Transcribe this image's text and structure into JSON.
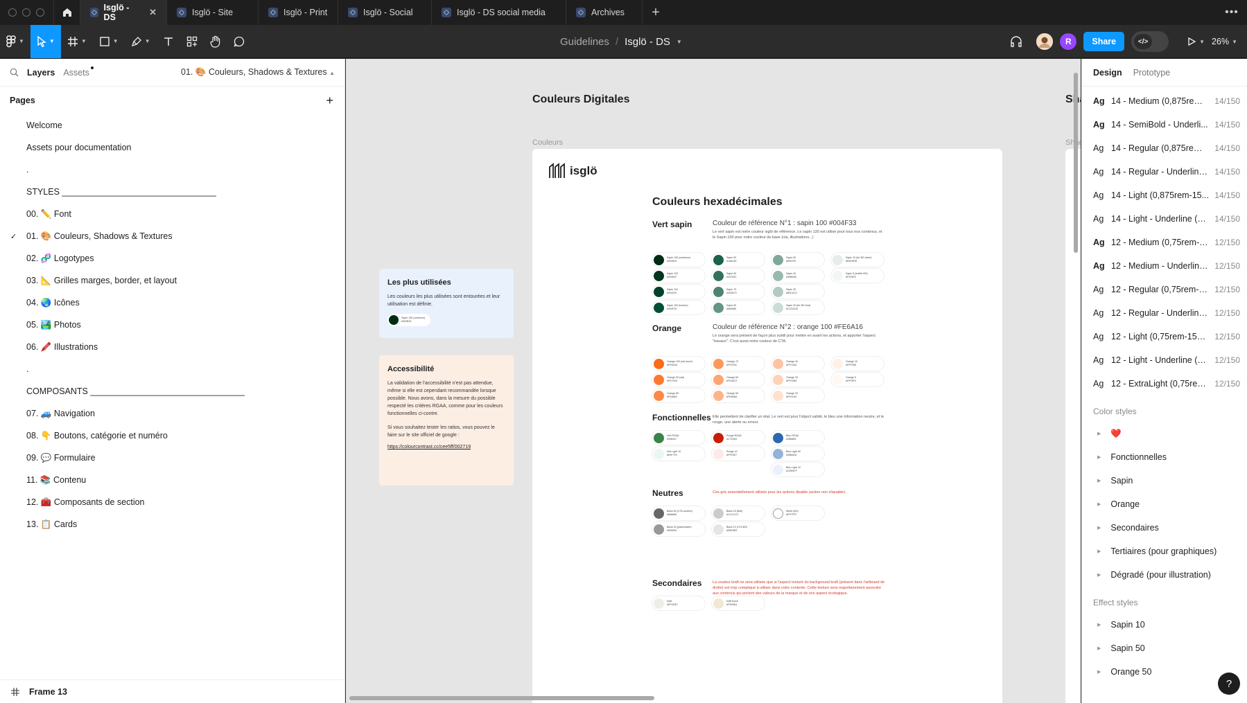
{
  "tabs": [
    {
      "label": "Isglö - DS",
      "active": true
    },
    {
      "label": "Isglö - Site"
    },
    {
      "label": "Isglö - Print"
    },
    {
      "label": "Isglö - Social"
    },
    {
      "label": "Isglö - DS social media"
    },
    {
      "label": "Archives"
    }
  ],
  "toolbar": {
    "breadcrumb_parent": "Guidelines",
    "breadcrumb_sep": "/",
    "breadcrumb_current": "Isglö - DS",
    "avatar_r": "R",
    "share_label": "Share",
    "zoom": "26%"
  },
  "left_panel": {
    "tab_layers": "Layers",
    "tab_assets": "Assets",
    "current_page": "01. 🎨 Couleurs, Shadows & Textures",
    "pages_title": "Pages",
    "pages": [
      {
        "label": "Welcome"
      },
      {
        "label": "Assets pour documentation"
      },
      {
        "label": "."
      },
      {
        "label": "STYLES ________________________________"
      },
      {
        "label": "00. ✏️ Font"
      },
      {
        "label": "01. 🎨 Couleurs, Shadows & Textures",
        "current": true
      },
      {
        "label": "02. 🧬 Logotypes"
      },
      {
        "label": "03. 📐 Grilles marges, border, et layout"
      },
      {
        "label": "04. 🌏 Icônes"
      },
      {
        "label": "05. 🏞️ Photos"
      },
      {
        "label": "06. 🖍️ Illustrations"
      },
      {
        "label": "."
      },
      {
        "label": "COMPOSANTS ________________________________"
      },
      {
        "label": "07. 🚙 Navigation"
      },
      {
        "label": "08. 👇 Boutons, catégorie et numéro"
      },
      {
        "label": "09. 💬 Formulaire"
      },
      {
        "label": "11. 📚 Contenu"
      },
      {
        "label": "12. 🧰 Composants de section"
      },
      {
        "label": "13. 📋 Cards"
      }
    ],
    "footer_label": "Frame 13"
  },
  "canvas": {
    "frame_title": "Couleurs Digitales",
    "frame_label": "Couleurs",
    "peek_title": "Sha",
    "peek_label": "Shad",
    "logo_text": "isglö",
    "main_title": "Couleurs hexadécimales",
    "card_used": {
      "title": "Les plus utilisées",
      "text": "Les couleurs les plus utilisées sont entourées et leur utilisation est définie.",
      "chip_name": "Sapin 130 (contenus)",
      "chip_hex": "#002B15",
      "chip_color": "#002B15"
    },
    "card_access": {
      "title": "Accessibilité",
      "text1": "La validation de l'accessibilité n'est pas attendue, même si elle est cependant recommandée lorsque possible. Nous avons, dans la mesure du possible respecté les critères RGAA, comme pour les couleurs fonctionnelles ci-contre.",
      "text2": "Si vous souhaitez tester les ratios, vous pouvez le faire sur le site officiel de google :",
      "link": "https://colourcontrast.cc/cee5ff/002719"
    },
    "sections": [
      {
        "name": "Vert sapin",
        "ref": "Couleur de référence N°1 : sapin 100 #004F33",
        "desc": "Le vert sapin est notre couleur isglö de référence. Le sapin 130 est utilisé pour tous nos contenus, et le Sapin 100 pour notre couleur de base (cta, illustrations...)",
        "swatches": [
          {
            "name": "Sapin 130 (contenus)",
            "hex": "#002B15",
            "color": "#002B15"
          },
          {
            "name": "Sapin 120",
            "hex": "#00351F",
            "color": "#00351F"
          },
          {
            "name": "Sapin 110",
            "hex": "#004229",
            "color": "#004229"
          },
          {
            "name": "Sapin 100 (bouton)",
            "hex": "#004F33",
            "color": "#004F33"
          },
          {
            "name": "Sapin 90",
            "hex": "#1A614E",
            "color": "#1A614E"
          },
          {
            "name": "Sapin 80",
            "hex": "#33725C",
            "color": "#33725C"
          },
          {
            "name": "Sapin 70",
            "hex": "#4D8470",
            "color": "#4D8470"
          },
          {
            "name": "Sapin 60",
            "hex": "#669585",
            "color": "#669585"
          },
          {
            "name": "Sapin 50",
            "hex": "#80A799",
            "color": "#80A799"
          },
          {
            "name": "Sapin 40",
            "hex": "#99B9AD",
            "color": "#99B9AD"
          },
          {
            "name": "Sapin 30",
            "hex": "#B3CAC2",
            "color": "#B3CAC2"
          },
          {
            "name": "Sapin 20 (fer BG brut)",
            "hex": "#CCDCD6",
            "color": "#CCDCD6"
          },
          {
            "name": "Sapin 10 (fer BG claire)",
            "hex": "#E6EDEB",
            "color": "#E6EDEB"
          },
          {
            "name": "Sapin 5 (entête BG)",
            "hex": "#F2F6F5",
            "color": "#F2F6F5"
          }
        ]
      },
      {
        "name": "Orange",
        "ref": "Couleur de référence N°2 : orange 100 #FE6A16",
        "desc": "Le orange sera présent de façon plus subtil pour mettre en avant les actions, et apporter l'aspect \"travaux\". C'est aussi notre couleur de CTA.",
        "swatches": [
          {
            "name": "Orange 100 (cta hover)",
            "hex": "#FE6A16",
            "color": "#FE6A16"
          },
          {
            "name": "Orange 90 (cta)",
            "hex": "#FE792D",
            "color": "#FE792D"
          },
          {
            "name": "Orange 80",
            "hex": "#FE8845",
            "color": "#FE8845"
          },
          {
            "name": "Orange 70",
            "hex": "#FE975C",
            "color": "#FE975C"
          },
          {
            "name": "Orange 60",
            "hex": "#FEA673",
            "color": "#FEA673"
          },
          {
            "name": "Orange 50",
            "hex": "#FEB48A",
            "color": "#FEB48A"
          },
          {
            "name": "Orange 40",
            "hex": "#FFC3A2",
            "color": "#FFC3A2"
          },
          {
            "name": "Orange 30",
            "hex": "#FFD2B9",
            "color": "#FFD2B9"
          },
          {
            "name": "Orange 20",
            "hex": "#FFE1D0",
            "color": "#FFE1D0"
          },
          {
            "name": "Orange 10",
            "hex": "#FFF0E8",
            "color": "#FFF0E8"
          },
          {
            "name": "Orange 5",
            "hex": "#FFF8F3",
            "color": "#FFF8F3"
          }
        ]
      },
      {
        "name": "Fonctionnelles",
        "ref": "",
        "desc": "Elle permettent de clarifier un état. Le vert est pour l'object validé, le bleu une information neutre, et le rouge, une alerte ou erreur.",
        "swatches": [
          {
            "name": "Vert RGAA",
            "hex": "#398447",
            "color": "#398447"
          },
          {
            "name": "Vert Light 10",
            "hex": "#E9F7F0",
            "color": "#E9F7F0"
          },
          {
            "name": "Rouge RGAA",
            "hex": "#C71D00",
            "color": "#C71D00"
          },
          {
            "name": "Rouge 10",
            "hex": "#FFE9E7",
            "color": "#FFE9E7"
          },
          {
            "name": "Bleu RGAA",
            "hex": "#2B68B1",
            "color": "#2B68B1"
          },
          {
            "name": "Bleu Light 50",
            "hex": "#95B3D8",
            "color": "#95B3D8"
          },
          {
            "name": "Bleu Light 10",
            "hex": "#CEE5FF",
            "color": "#EAF1FB"
          }
        ]
      },
      {
        "name": "Neutres",
        "ref": "",
        "desc": "Ces gris essentiellement utilisés pour les actions disable (action non cliquable).",
        "desc_red": true,
        "swatches": [
          {
            "name": "Black 60 (CTA content)",
            "hex": "#666666",
            "color": "#666666"
          },
          {
            "name": "Black 40 (placeholder)",
            "hex": "#999999",
            "color": "#999999"
          },
          {
            "name": "Black 20 (Bell)",
            "hex": "#CCCCCC",
            "color": "#CCCCCC"
          },
          {
            "name": "Black 10 (CTA BG)",
            "hex": "#E5E5E5",
            "color": "#E5E5E5"
          },
          {
            "name": "White (BG)",
            "hex": "#FFFFFF",
            "color": "#FFFFFF"
          }
        ]
      },
      {
        "name": "Secondaires",
        "ref": "",
        "desc": "La couleur kraft ne sera utilisée que si l'aspect texturé du background kraft (présent dans l'artboard de droite) est trop compliqué à utiliser dans votre contexte. Cette texture sera majoritairement associée aux contenus qui portent des valeurs de la marque et de son aspect écologique.",
        "desc_red": true,
        "swatches": [
          {
            "name": "kraft",
            "hex": "#EFEDE7",
            "color": "#EFEDE7"
          },
          {
            "name": "kraft foncé",
            "hex": "#F0E8D4",
            "color": "#F0E8D4"
          }
        ]
      }
    ]
  },
  "right_panel": {
    "tab_design": "Design",
    "tab_prototype": "Prototype",
    "text_styles": [
      {
        "name": "14 - Medium (0,875rem-...",
        "size": "14/150",
        "weight": 500
      },
      {
        "name": "14 - SemiBold - Underli...",
        "size": "14/150",
        "weight": 600
      },
      {
        "name": "14 - Regular (0,875rem-...",
        "size": "14/150",
        "weight": 400
      },
      {
        "name": "14 - Regular - Underline...",
        "size": "14/150",
        "weight": 400
      },
      {
        "name": "14 - Light (0,875rem-15...",
        "size": "14/150",
        "weight": 300
      },
      {
        "name": "14 - Light - Underline (0...",
        "size": "14/150",
        "weight": 300
      },
      {
        "name": "12 - Medium (0,75rem-1...",
        "size": "12/150",
        "weight": 500
      },
      {
        "name": "12 - Medium - Underline...",
        "size": "12/150",
        "weight": 500
      },
      {
        "name": "12 - Regular (0,75rem-1...",
        "size": "12/150",
        "weight": 400
      },
      {
        "name": "12 - Regular - Underline ...",
        "size": "12/150",
        "weight": 400
      },
      {
        "name": "12 - Light (0,75rem-150%)",
        "size": "12/150",
        "weight": 300
      },
      {
        "name": "12 - Light - Underline (0,...",
        "size": "12/150",
        "weight": 300
      },
      {
        "name": "12 - ExtraLight (0,75rem...",
        "size": "12/150",
        "weight": 200
      }
    ],
    "ag_label": "Ag",
    "color_styles_title": "Color styles",
    "color_styles": [
      "❤️",
      "Fonctionnelles",
      "Sapin",
      "Orange",
      "Secondaires",
      "Tertiaires (pour graphiques)",
      "Dégradé (pour illustration)"
    ],
    "effect_styles_title": "Effect styles",
    "effect_styles": [
      "Sapin 10",
      "Sapin 50",
      "Orange 50"
    ],
    "help_label": "?"
  }
}
